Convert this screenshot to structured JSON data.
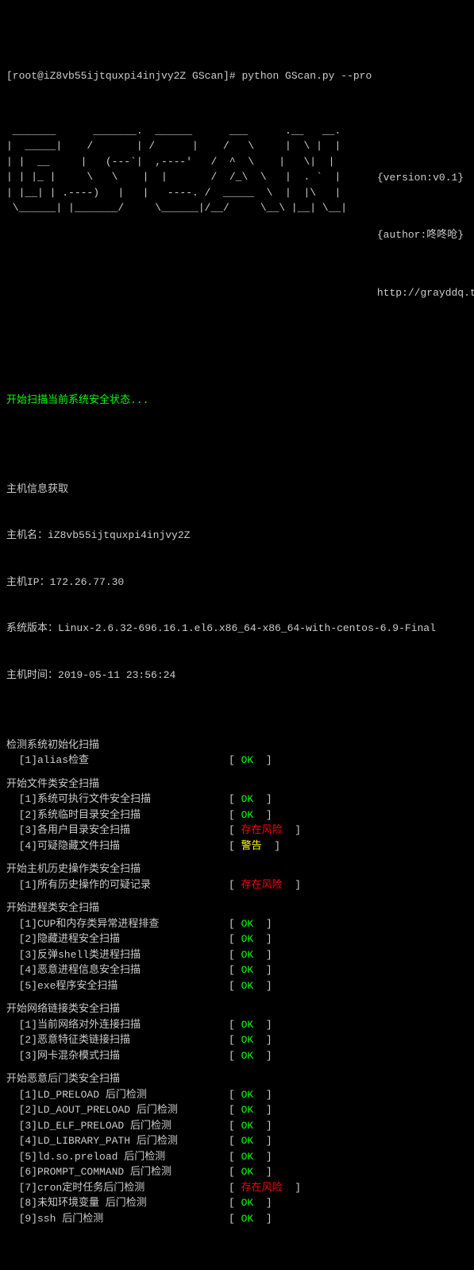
{
  "prompt": "[root@iZ8vb55ijtquxpi4injvy2Z GScan]# python GScan.py --pro",
  "ascii": " _______      _______.  ______      ___      .__   __. \n|  _____|    /       | /      |    /   \\     |  \\ |  | \n| |  __     |   (---`|  ,----'   /  ^  \\    |   \\|  | \n| | |_ |     \\   \\    |  |       /  /_\\  \\   |  . `  | \n| |__| | .----)   |   |   ----. /  _____  \\  |  |\\   | \n \\______| |_______/     \\______|/__/     \\__\\ |__| \\__| ",
  "meta": {
    "version": "{version:v0.1}",
    "author": "{author:咚咚呛}",
    "url": "http://grayddq.top"
  },
  "scan_start": "开始扫描当前系统安全状态...",
  "hostinfo": {
    "header": "主机信息获取",
    "hostname_label": "主机名：",
    "hostname": "iZ8vb55ijtquxpi4injvy2Z",
    "ip_label": "主机IP：",
    "ip": "172.26.77.30",
    "os_label": "系统版本：",
    "os": "Linux-2.6.32-696.16.1.el6.x86_64-x86_64-with-centos-6.9-Final",
    "time_label": "主机时间：",
    "time": "2019-05-11 23:56:24"
  },
  "groups": [
    {
      "title": "检测系统初始化扫描",
      "items": [
        {
          "label": "  [1]alias检查",
          "status": "OK",
          "class": "ok"
        }
      ]
    },
    {
      "title": "开始文件类安全扫描",
      "items": [
        {
          "label": "  [1]系统可执行文件安全扫描",
          "status": "OK",
          "class": "ok"
        },
        {
          "label": "  [2]系统临时目录安全扫描",
          "status": "OK",
          "class": "ok"
        },
        {
          "label": "  [3]各用户目录安全扫描",
          "status": "存在风险",
          "class": "risk"
        },
        {
          "label": "  [4]可疑隐藏文件扫描",
          "status": "警告",
          "class": "warn"
        }
      ]
    },
    {
      "title": "开始主机历史操作类安全扫描",
      "items": [
        {
          "label": "  [1]所有历史操作的可疑记录",
          "status": "存在风险",
          "class": "risk"
        }
      ]
    },
    {
      "title": "开始进程类安全扫描",
      "items": [
        {
          "label": "  [1]CUP和内存类异常进程排查",
          "status": "OK",
          "class": "ok"
        },
        {
          "label": "  [2]隐藏进程安全扫描",
          "status": "OK",
          "class": "ok"
        },
        {
          "label": "  [3]反弹shell类进程扫描",
          "status": "OK",
          "class": "ok"
        },
        {
          "label": "  [4]恶意进程信息安全扫描",
          "status": "OK",
          "class": "ok"
        },
        {
          "label": "  [5]exe程序安全扫描",
          "status": "OK",
          "class": "ok"
        }
      ]
    },
    {
      "title": "开始网络链接类安全扫描",
      "items": [
        {
          "label": "  [1]当前网络对外连接扫描",
          "status": "OK",
          "class": "ok"
        },
        {
          "label": "  [2]恶意特征类链接扫描",
          "status": "OK",
          "class": "ok"
        },
        {
          "label": "  [3]网卡混杂模式扫描",
          "status": "OK",
          "class": "ok"
        }
      ]
    },
    {
      "title": "开始恶意后门类安全扫描",
      "items": [
        {
          "label": "  [1]LD_PRELOAD 后门检测",
          "status": "OK",
          "class": "ok"
        },
        {
          "label": "  [2]LD_AOUT_PRELOAD 后门检测",
          "status": "OK",
          "class": "ok"
        },
        {
          "label": "  [3]LD_ELF_PRELOAD 后门检测",
          "status": "OK",
          "class": "ok"
        },
        {
          "label": "  [4]LD_LIBRARY_PATH 后门检测",
          "status": "OK",
          "class": "ok"
        },
        {
          "label": "  [5]ld.so.preload 后门检测",
          "status": "OK",
          "class": "ok"
        },
        {
          "label": "  [6]PROMPT_COMMAND 后门检测",
          "status": "OK",
          "class": "ok"
        },
        {
          "label": "  [7]cron定时任务后门检测",
          "status": "存在风险",
          "class": "risk"
        },
        {
          "label": "  [8]未知环境变量 后门检测",
          "status": "OK",
          "class": "ok"
        },
        {
          "label": "  [9]ssh 后门检测",
          "status": "OK",
          "class": "ok"
        }
      ]
    }
  ]
}
